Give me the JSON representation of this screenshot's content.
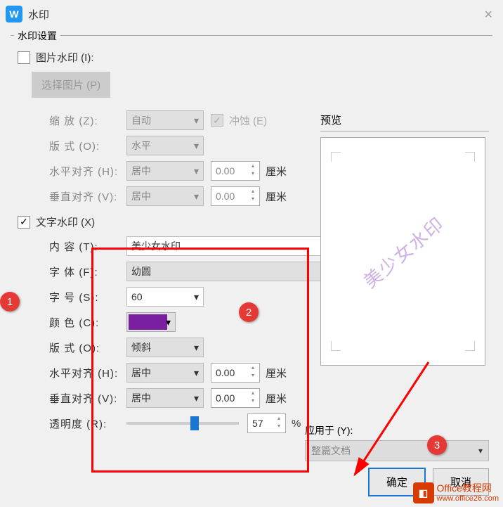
{
  "window": {
    "title": "水印"
  },
  "group": {
    "title": "水印设置"
  },
  "img_wm": {
    "label": "图片水印 (I):",
    "select_pic": "选择图片 (P)",
    "zoom_label": "缩   放 (Z):",
    "zoom_value": "自动",
    "washout": "冲蚀 (E)",
    "layout_label": "版   式 (O):",
    "layout_value": "水平",
    "h_align_label": "水平对齐 (H):",
    "h_align_value": "居中",
    "h_align_num": "0.00",
    "v_align_label": "垂直对齐 (V):",
    "v_align_value": "居中",
    "v_align_num": "0.00",
    "unit": "厘米"
  },
  "txt_wm": {
    "label": "文字水印 (X)",
    "content_label": "内   容 (T):",
    "content_value": "美少女水印",
    "font_label": "字   体 (F):",
    "font_value": "幼圆",
    "size_label": "字   号 (S):",
    "size_value": "60",
    "color_label": "颜   色 (C):",
    "layout_label": "版   式 (O):",
    "layout_value": "倾斜",
    "h_align_label": "水平对齐 (H):",
    "h_align_value": "居中",
    "h_align_num": "0.00",
    "v_align_label": "垂直对齐 (V):",
    "v_align_value": "居中",
    "v_align_num": "0.00",
    "unit": "厘米",
    "opacity_label": "透明度 (R):",
    "opacity_value": "57",
    "percent": "%"
  },
  "preview": {
    "label": "预览",
    "text": "美少女水印"
  },
  "apply": {
    "label": "应用于 (Y):",
    "value": "整篇文档"
  },
  "buttons": {
    "ok": "确定",
    "cancel": "取消"
  },
  "annotations": {
    "c1": "1",
    "c2": "2",
    "c3": "3"
  },
  "footer": {
    "brand1": "Office教程网",
    "brand2": "www.office26.com"
  }
}
